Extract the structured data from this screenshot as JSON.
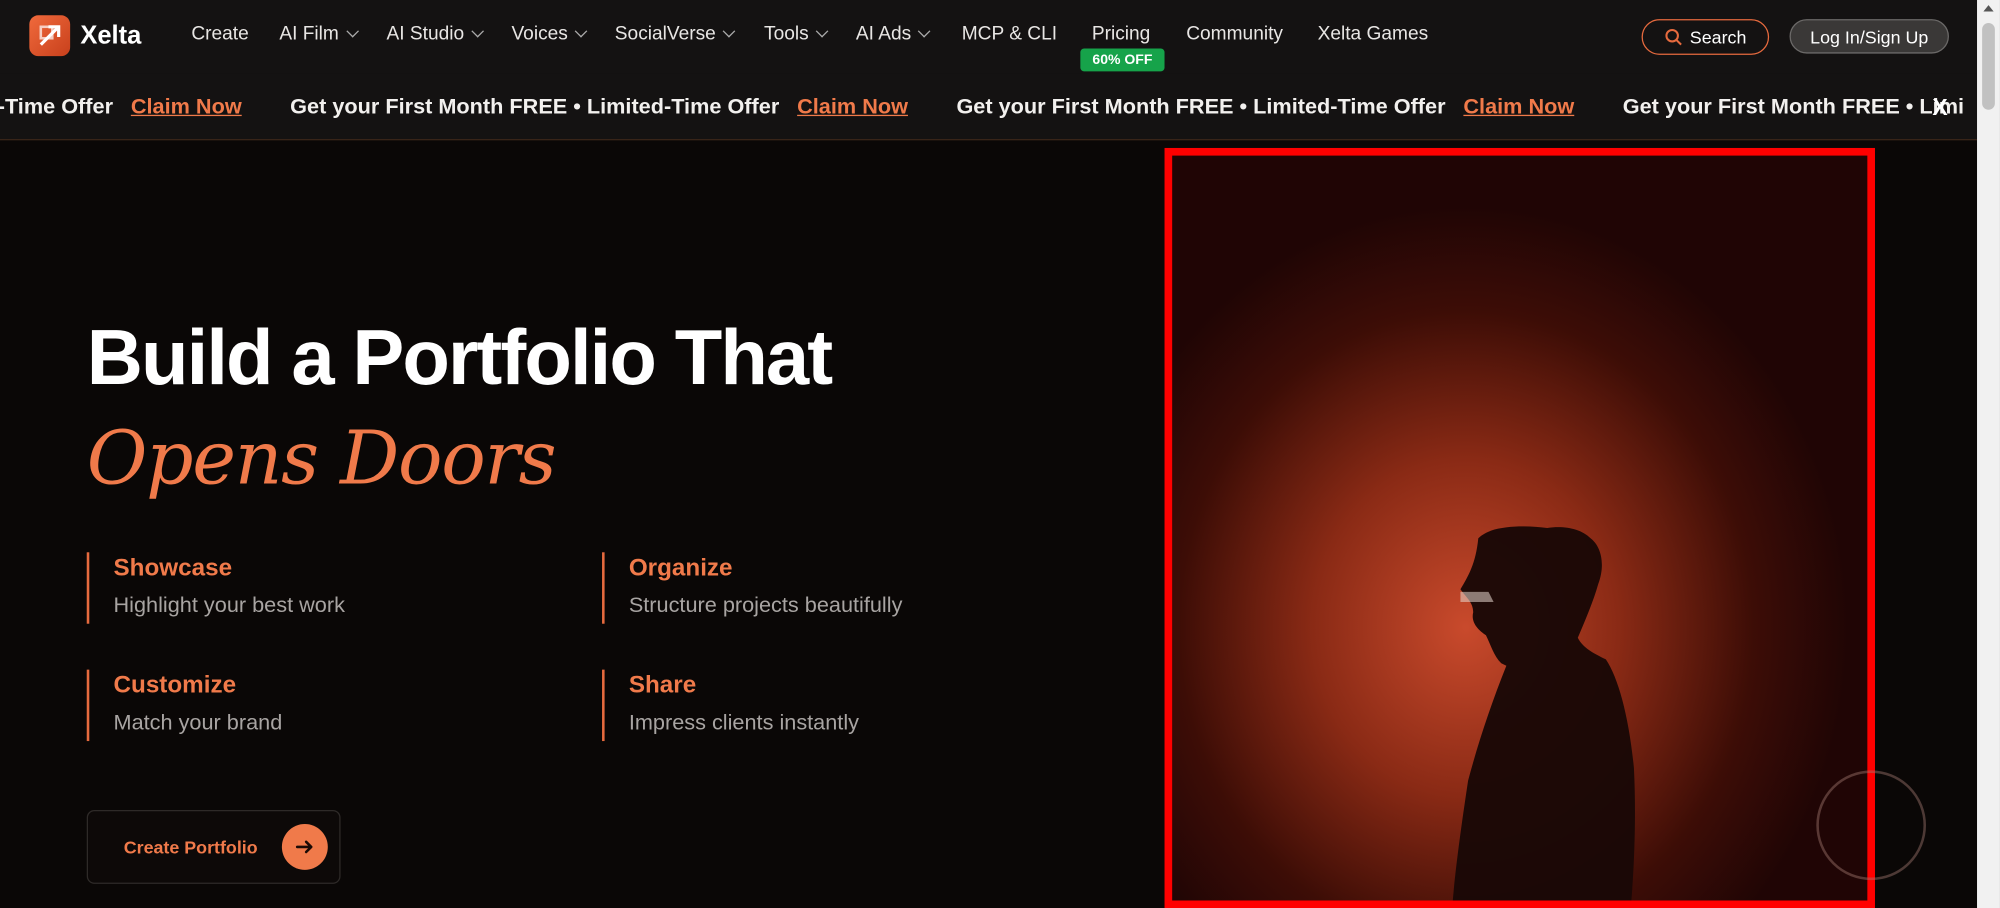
{
  "brand": {
    "name": "Xelta"
  },
  "nav": {
    "items": [
      {
        "label": "Create",
        "dropdown": false
      },
      {
        "label": "AI Film",
        "dropdown": true
      },
      {
        "label": "AI Studio",
        "dropdown": true
      },
      {
        "label": "Voices",
        "dropdown": true
      },
      {
        "label": "SocialVerse",
        "dropdown": true
      },
      {
        "label": "Tools",
        "dropdown": true
      },
      {
        "label": "AI Ads",
        "dropdown": true
      },
      {
        "label": "MCP & CLI",
        "dropdown": false
      },
      {
        "label": "Pricing",
        "dropdown": false
      },
      {
        "label": "Community",
        "dropdown": false
      },
      {
        "label": "Xelta Games",
        "dropdown": false
      }
    ],
    "pricing_badge": "60% OFF",
    "search_label": "Search",
    "login_label": "Log In/Sign Up"
  },
  "promo": {
    "first_partial": "ited-Time Offer",
    "text": "Get your First Month FREE • Limited-Time Offer",
    "claim": "Claim Now",
    "last_partial": "Get your First Month FREE • Limi",
    "close": "X"
  },
  "hero": {
    "title_line1": "Build a Portfolio That",
    "title_line2": "Opens Doors",
    "features": [
      {
        "title": "Showcase",
        "desc": "Highlight your best work"
      },
      {
        "title": "Organize",
        "desc": "Structure projects beautifully"
      },
      {
        "title": "Customize",
        "desc": "Match your brand"
      },
      {
        "title": "Share",
        "desc": "Impress clients instantly"
      }
    ],
    "cta_label": "Create Portfolio"
  },
  "colors": {
    "accent": "#f07a4a",
    "badge": "#16a34a",
    "highlight_border": "#ff0000"
  }
}
